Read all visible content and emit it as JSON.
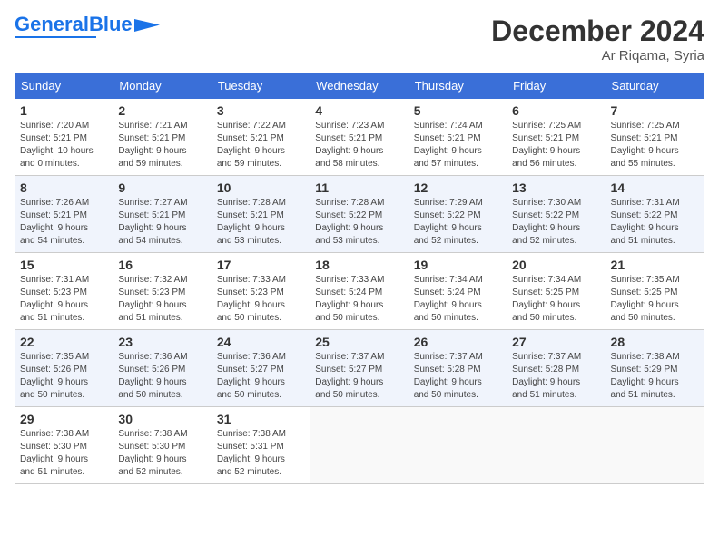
{
  "header": {
    "logo_general": "General",
    "logo_blue": "Blue",
    "month_title": "December 2024",
    "location": "Ar Riqama, Syria"
  },
  "weekdays": [
    "Sunday",
    "Monday",
    "Tuesday",
    "Wednesday",
    "Thursday",
    "Friday",
    "Saturday"
  ],
  "weeks": [
    [
      {
        "day": "1",
        "info": "Sunrise: 7:20 AM\nSunset: 5:21 PM\nDaylight: 10 hours\nand 0 minutes."
      },
      {
        "day": "2",
        "info": "Sunrise: 7:21 AM\nSunset: 5:21 PM\nDaylight: 9 hours\nand 59 minutes."
      },
      {
        "day": "3",
        "info": "Sunrise: 7:22 AM\nSunset: 5:21 PM\nDaylight: 9 hours\nand 59 minutes."
      },
      {
        "day": "4",
        "info": "Sunrise: 7:23 AM\nSunset: 5:21 PM\nDaylight: 9 hours\nand 58 minutes."
      },
      {
        "day": "5",
        "info": "Sunrise: 7:24 AM\nSunset: 5:21 PM\nDaylight: 9 hours\nand 57 minutes."
      },
      {
        "day": "6",
        "info": "Sunrise: 7:25 AM\nSunset: 5:21 PM\nDaylight: 9 hours\nand 56 minutes."
      },
      {
        "day": "7",
        "info": "Sunrise: 7:25 AM\nSunset: 5:21 PM\nDaylight: 9 hours\nand 55 minutes."
      }
    ],
    [
      {
        "day": "8",
        "info": "Sunrise: 7:26 AM\nSunset: 5:21 PM\nDaylight: 9 hours\nand 54 minutes."
      },
      {
        "day": "9",
        "info": "Sunrise: 7:27 AM\nSunset: 5:21 PM\nDaylight: 9 hours\nand 54 minutes."
      },
      {
        "day": "10",
        "info": "Sunrise: 7:28 AM\nSunset: 5:21 PM\nDaylight: 9 hours\nand 53 minutes."
      },
      {
        "day": "11",
        "info": "Sunrise: 7:28 AM\nSunset: 5:22 PM\nDaylight: 9 hours\nand 53 minutes."
      },
      {
        "day": "12",
        "info": "Sunrise: 7:29 AM\nSunset: 5:22 PM\nDaylight: 9 hours\nand 52 minutes."
      },
      {
        "day": "13",
        "info": "Sunrise: 7:30 AM\nSunset: 5:22 PM\nDaylight: 9 hours\nand 52 minutes."
      },
      {
        "day": "14",
        "info": "Sunrise: 7:31 AM\nSunset: 5:22 PM\nDaylight: 9 hours\nand 51 minutes."
      }
    ],
    [
      {
        "day": "15",
        "info": "Sunrise: 7:31 AM\nSunset: 5:23 PM\nDaylight: 9 hours\nand 51 minutes."
      },
      {
        "day": "16",
        "info": "Sunrise: 7:32 AM\nSunset: 5:23 PM\nDaylight: 9 hours\nand 51 minutes."
      },
      {
        "day": "17",
        "info": "Sunrise: 7:33 AM\nSunset: 5:23 PM\nDaylight: 9 hours\nand 50 minutes."
      },
      {
        "day": "18",
        "info": "Sunrise: 7:33 AM\nSunset: 5:24 PM\nDaylight: 9 hours\nand 50 minutes."
      },
      {
        "day": "19",
        "info": "Sunrise: 7:34 AM\nSunset: 5:24 PM\nDaylight: 9 hours\nand 50 minutes."
      },
      {
        "day": "20",
        "info": "Sunrise: 7:34 AM\nSunset: 5:25 PM\nDaylight: 9 hours\nand 50 minutes."
      },
      {
        "day": "21",
        "info": "Sunrise: 7:35 AM\nSunset: 5:25 PM\nDaylight: 9 hours\nand 50 minutes."
      }
    ],
    [
      {
        "day": "22",
        "info": "Sunrise: 7:35 AM\nSunset: 5:26 PM\nDaylight: 9 hours\nand 50 minutes."
      },
      {
        "day": "23",
        "info": "Sunrise: 7:36 AM\nSunset: 5:26 PM\nDaylight: 9 hours\nand 50 minutes."
      },
      {
        "day": "24",
        "info": "Sunrise: 7:36 AM\nSunset: 5:27 PM\nDaylight: 9 hours\nand 50 minutes."
      },
      {
        "day": "25",
        "info": "Sunrise: 7:37 AM\nSunset: 5:27 PM\nDaylight: 9 hours\nand 50 minutes."
      },
      {
        "day": "26",
        "info": "Sunrise: 7:37 AM\nSunset: 5:28 PM\nDaylight: 9 hours\nand 50 minutes."
      },
      {
        "day": "27",
        "info": "Sunrise: 7:37 AM\nSunset: 5:28 PM\nDaylight: 9 hours\nand 51 minutes."
      },
      {
        "day": "28",
        "info": "Sunrise: 7:38 AM\nSunset: 5:29 PM\nDaylight: 9 hours\nand 51 minutes."
      }
    ],
    [
      {
        "day": "29",
        "info": "Sunrise: 7:38 AM\nSunset: 5:30 PM\nDaylight: 9 hours\nand 51 minutes."
      },
      {
        "day": "30",
        "info": "Sunrise: 7:38 AM\nSunset: 5:30 PM\nDaylight: 9 hours\nand 52 minutes."
      },
      {
        "day": "31",
        "info": "Sunrise: 7:38 AM\nSunset: 5:31 PM\nDaylight: 9 hours\nand 52 minutes."
      },
      null,
      null,
      null,
      null
    ]
  ]
}
